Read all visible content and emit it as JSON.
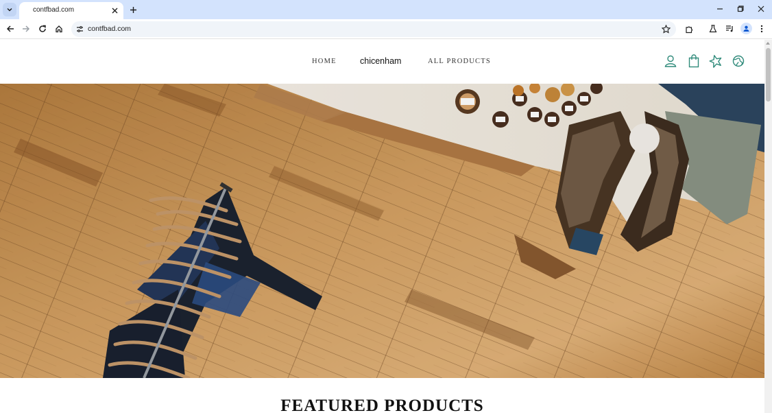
{
  "browser": {
    "tab_title": "contfbad.com",
    "url": "contfbad.com"
  },
  "nav": {
    "home": "HOME",
    "brand": "chicenham",
    "all_products": "ALL PRODUCTS"
  },
  "icons": {
    "account": "user-icon",
    "cart": "shopping-bag-icon",
    "wishlist": "star-icon",
    "region": "globe-icon"
  },
  "colors": {
    "accent": "#2f8a7a",
    "tabbar": "#d3e3fd"
  },
  "sections": {
    "featured_title": "FEATURED PRODUCTS"
  }
}
